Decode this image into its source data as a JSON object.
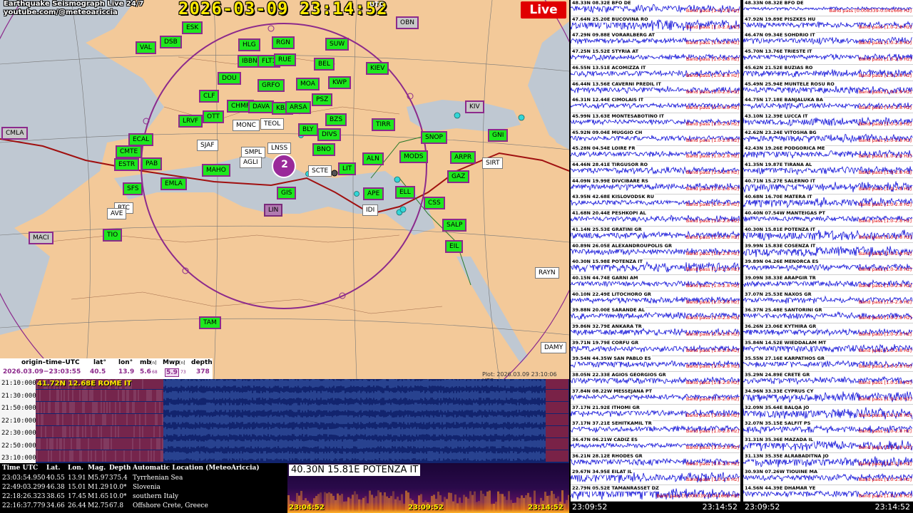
{
  "header": {
    "channel_title_line1": "Earthquake Seismograph Live 24/7",
    "channel_title_line2": "youtube.com/@meteoariccia",
    "clock": "2026-03-09  23:14:52",
    "clock_tz": "UTC",
    "live_label": "Live"
  },
  "map": {
    "plot_time": "Plot: 2026.03.09  23:10:06  UTC",
    "epicenter_label": "2",
    "colors": {
      "land": "#f3c999",
      "sea": "#bfc8d2",
      "border": "#8c2a8c",
      "ridge": "#a01010"
    },
    "stations": [
      {
        "code": "ESK",
        "style": "normal"
      },
      {
        "code": "VAL",
        "style": "normal"
      },
      {
        "code": "DSB",
        "style": "normal"
      },
      {
        "code": "HLG",
        "style": "normal"
      },
      {
        "code": "RGN",
        "style": "normal"
      },
      {
        "code": "SUW",
        "style": "normal"
      },
      {
        "code": "OBN",
        "style": "gray"
      },
      {
        "code": "IBBN",
        "style": "normal"
      },
      {
        "code": "FLT1",
        "style": "normal"
      },
      {
        "code": "RUE",
        "style": "normal"
      },
      {
        "code": "BEL",
        "style": "normal"
      },
      {
        "code": "KIEV",
        "style": "normal"
      },
      {
        "code": "DOU",
        "style": "normal"
      },
      {
        "code": "GRFO",
        "style": "normal"
      },
      {
        "code": "MOA",
        "style": "normal"
      },
      {
        "code": "KWP",
        "style": "normal"
      },
      {
        "code": "CLF",
        "style": "normal"
      },
      {
        "code": "CHMF",
        "style": "normal"
      },
      {
        "code": "DAVA",
        "style": "normal"
      },
      {
        "code": "KBA",
        "style": "normal"
      },
      {
        "code": "ARSA",
        "style": "normal"
      },
      {
        "code": "PSZ",
        "style": "normal"
      },
      {
        "code": "BZS",
        "style": "normal"
      },
      {
        "code": "TIRR",
        "style": "normal"
      },
      {
        "code": "LRVF",
        "style": "normal"
      },
      {
        "code": "OTT",
        "style": "normal"
      },
      {
        "code": "MONC",
        "style": "white"
      },
      {
        "code": "TEOL",
        "style": "white"
      },
      {
        "code": "BLY",
        "style": "normal"
      },
      {
        "code": "DIVS",
        "style": "normal"
      },
      {
        "code": "KIV",
        "style": "gray"
      },
      {
        "code": "GNI",
        "style": "normal"
      },
      {
        "code": "CMLA",
        "style": "gray"
      },
      {
        "code": "ECAL",
        "style": "normal"
      },
      {
        "code": "SJAF",
        "style": "white"
      },
      {
        "code": "SMPL",
        "style": "white"
      },
      {
        "code": "LNSS",
        "style": "white"
      },
      {
        "code": "BNO",
        "style": "normal"
      },
      {
        "code": "SNOP",
        "style": "normal"
      },
      {
        "code": "ARPR",
        "style": "normal"
      },
      {
        "code": "CMTE",
        "style": "normal"
      },
      {
        "code": "PAB",
        "style": "normal"
      },
      {
        "code": "AGLI",
        "style": "white"
      },
      {
        "code": "ALN",
        "style": "normal"
      },
      {
        "code": "MODS",
        "style": "normal"
      },
      {
        "code": "GAZ",
        "style": "normal"
      },
      {
        "code": "SIRT",
        "style": "white"
      },
      {
        "code": "MAHO",
        "style": "normal"
      },
      {
        "code": "SCTE",
        "style": "white"
      },
      {
        "code": "LIT",
        "style": "normal"
      },
      {
        "code": "ESTR",
        "style": "normal"
      },
      {
        "code": "SFS",
        "style": "normal"
      },
      {
        "code": "EMLA",
        "style": "normal"
      },
      {
        "code": "GIS",
        "style": "normal"
      },
      {
        "code": "APE",
        "style": "normal"
      },
      {
        "code": "ELL",
        "style": "normal"
      },
      {
        "code": "CSS",
        "style": "normal"
      },
      {
        "code": "RTC",
        "style": "white"
      },
      {
        "code": "AVE",
        "style": "white"
      },
      {
        "code": "IDI",
        "style": "white"
      },
      {
        "code": "LIN",
        "style": "purple"
      },
      {
        "code": "TIO",
        "style": "normal"
      },
      {
        "code": "SALP",
        "style": "normal"
      },
      {
        "code": "MACI",
        "style": "gray"
      },
      {
        "code": "EIL",
        "style": "normal"
      },
      {
        "code": "RAYN",
        "style": "white"
      },
      {
        "code": "TAM",
        "style": "normal"
      },
      {
        "code": "DAMY",
        "style": "white"
      }
    ]
  },
  "event": {
    "headers": {
      "origin": "origin–time–UTC",
      "lat": "lat°",
      "lon": "lon°",
      "mb": "mb",
      "mb_sub": "[n]",
      "mwp": "Mwp",
      "mwp_sub": "[n]",
      "depth": "depth"
    },
    "values": {
      "origin": "2026.03.09−23:03:55",
      "lat": "40.5",
      "lon": "13.9",
      "mb": "5.6",
      "mb_n": "68",
      "mwp": "5.9",
      "mwp_n": "73",
      "depth": "378"
    }
  },
  "helicorder": {
    "station_label": "41.72N 12.68E ROME IT",
    "times": [
      "21:10:000",
      "21:30:000",
      "21:50:000",
      "22:10:000",
      "22:30:000",
      "22:50:000",
      "23:10:000"
    ]
  },
  "quake_list": {
    "headers": [
      "Time UTC",
      "Lat.",
      "Lon.",
      "Mag.",
      "Depth",
      "Automatic Location (MeteoAriccia)"
    ],
    "rows": [
      [
        "23:03:54.950",
        "40.55",
        "13.91",
        "M5.97",
        "375.4",
        "Tyrrhenian Sea"
      ],
      [
        "22:49:03.299",
        "46.38",
        "15.01",
        "M1.29",
        "10.0*",
        "Slovenia"
      ],
      [
        "22:18:26.323",
        "38.65",
        "17.45",
        "M1.65",
        "10.0*",
        "southern Italy"
      ],
      [
        "22:16:37.779",
        "34.66",
        "26.44",
        "M2.75",
        "67.8",
        "Offshore Crete, Greece"
      ]
    ]
  },
  "spectrogram": {
    "station_label": "40.30N 15.81E POTENZA IT",
    "times": [
      "23:04:52",
      "23:09:52",
      "23:14:52"
    ]
  },
  "seismograms": {
    "footer_start": "23:09:52",
    "footer_end": "23:14:52",
    "band_default": "Band pass [1.0-2.8 Hz]",
    "left": [
      {
        "label": "48.33N 08.32E BFO DE",
        "band": "Band pass [1.0-2.8 Hz]",
        "amp": 0.7
      },
      {
        "label": "47.64N 25.20E BUCOVINA RO",
        "band": "Band pass [1.0-2.8 Hz]",
        "amp": 1.0
      },
      {
        "label": "47.29N 09.88E VORARLBERG AT",
        "band": "Band pass [1.0-2.8 Hz]",
        "amp": 0.5
      },
      {
        "label": "47.25N 15.52E STYRIA AT",
        "band": "Band pass [1.0-2.8 Hz]",
        "amp": 0.5
      },
      {
        "label": "46.55N 13.51E ACOMIZZA IT",
        "band": "Band pass [1.0-2.8 Hz]",
        "amp": 0.6
      },
      {
        "label": "46.44N 13.56E CAVERNI PREDIL IT",
        "band": "Band pass [1.0-2.8 Hz]",
        "amp": 0.6
      },
      {
        "label": "46.31N 12.44E CIMOLAIS IT",
        "band": "Band pass [1.0-2.8 Hz]",
        "amp": 0.5
      },
      {
        "label": "45.99N 13.63E MONTESABOTINO IT",
        "band": "Band pass [1.0-2.8 Hz]",
        "amp": 0.5
      },
      {
        "label": "45.92N 09.04E MUGGIO CH",
        "band": "Band pass [1.0-2.8 Hz]",
        "amp": 0.5
      },
      {
        "label": "45.28N 04.54E LOIRE FR",
        "band": "Band pass [1.0-2.8 Hz]",
        "amp": 0.5
      },
      {
        "label": "44.46N 28.41E TIRGUSOR RO",
        "band": "Band pass [1.0-2.8 Hz]",
        "amp": 0.6
      },
      {
        "label": "44.09N 19.99E DIVCIBARE RS",
        "band": "Band pass [1.0-2.8 Hz]",
        "amp": 0.6
      },
      {
        "label": "43.95N 42.68E KISLOVODSK RU",
        "band": "Band pass [1.0-2.8 Hz]",
        "amp": 0.5
      },
      {
        "label": "41.68N 20.44E PESHKOPI AL",
        "band": "Band pass [1.0-2.8 Hz]",
        "amp": 0.6
      },
      {
        "label": "41.14N 25.53E GRATINI GR",
        "band": "Band pass [1.0-2.8 Hz]",
        "amp": 0.6
      },
      {
        "label": "40.89N 26.05E ALEXANDROUPOLIS GR",
        "band": "Band pass [1.0-2.8 Hz]",
        "amp": 0.6
      },
      {
        "label": "40.30N 15.98E POTENZA IT",
        "band": "Band pass [1.0-2.8 Hz]",
        "amp": 0.9
      },
      {
        "label": "40.15N 44.74E GARNI AM",
        "band": "Band pass [1.0-2.8 Hz]",
        "amp": 0.5
      },
      {
        "label": "40.10N 22.49E LITOCHORO GR",
        "band": "Band pass [1.0-2.8 Hz]",
        "amp": 0.6
      },
      {
        "label": "39.88N 20.00E SARANDE AL",
        "band": "Band pass [1.0-2.8 Hz]",
        "amp": 0.6
      },
      {
        "label": "39.86N 32.79E ANKARA TR",
        "band": "Band pass [1.0-2.8 Hz]",
        "amp": 0.6
      },
      {
        "label": "39.71N 19.79E CORFU GR",
        "band": "Band pass [1.0-2.8 Hz]",
        "amp": 0.6
      },
      {
        "label": "39.54N 44.35W SAN PABLO ES",
        "band": "Band pass [1.0-2.8 Hz]",
        "amp": 0.6
      },
      {
        "label": "38.05N 22.33E AGIOS GEORGIOS GR",
        "band": "Band pass [1.0-2.8 Hz]",
        "amp": 0.6
      },
      {
        "label": "37.84N 08.22W MESSEJANA PT",
        "band": "Band pass [1.0-2.8 Hz]",
        "amp": 0.5
      },
      {
        "label": "37.17N 21.92E ITHOMI GR",
        "band": "Band pass [1.0-2.8 Hz]",
        "amp": 0.6
      },
      {
        "label": "37.17N 37.21E SEHITKAMIL TR",
        "band": "Band pass [1.0-2.8 Hz]",
        "amp": 0.6
      },
      {
        "label": "36.47N 06.21W CADIZ ES",
        "band": "Band pass [1.0-2.8 Hz]",
        "amp": 0.5
      },
      {
        "label": "36.21N 28.12E RHODES GR",
        "band": "Band pass [1.0-2.8 Hz]",
        "amp": 0.6
      },
      {
        "label": "29.67N 34.95E EILAT IL",
        "band": "Band pass [1.0-2.8 Hz]",
        "amp": 0.9
      },
      {
        "label": "22.79N 05.52E TAMANRASSET DZ",
        "band": "Band pass [0.008339-0.041666 Hz]",
        "amp": 1.0
      }
    ],
    "right": [
      {
        "label": "48.33N 08.32E BFO DE",
        "band": "Band pass [0.008339-0.041666 Hz]",
        "amp": 0.3
      },
      {
        "label": "47.92N 19.89E PISZKES HU",
        "band": "Band pass [1.0-2.8 Hz]",
        "amp": 0.6
      },
      {
        "label": "46.47N 09.34E SOHDRIO IT",
        "band": "Band pass [1.0-2.8 Hz]",
        "amp": 0.6
      },
      {
        "label": "45.70N 13.76E TRIESTE IT",
        "band": "Band pass [1.0-2.8 Hz]",
        "amp": 0.6
      },
      {
        "label": "45.62N 21.52E BUZIAS RO",
        "band": "Band pass [1.0-2.8 Hz]",
        "amp": 0.7
      },
      {
        "label": "45.49N 25.94E MUNTELE ROSU RO",
        "band": "Band pass [1.0-2.8 Hz]",
        "amp": 0.7
      },
      {
        "label": "44.75N 17.18E BANJALUKA BA",
        "band": "Band pass [1.0-2.8 Hz]",
        "amp": 0.6
      },
      {
        "label": "43.10N 12.39E LUCCA IT",
        "band": "Band pass [1.0-2.8 Hz]",
        "amp": 0.7
      },
      {
        "label": "42.62N 23.24E VITOSHA BG",
        "band": "Band pass [1.0-2.8 Hz]",
        "amp": 0.7
      },
      {
        "label": "42.43N 19.26E PODGORICA ME",
        "band": "Band pass [1.0-2.8 Hz]",
        "amp": 0.7
      },
      {
        "label": "41.35N 19.87E TIRANA AL",
        "band": "Band pass [1.0-2.8 Hz]",
        "amp": 0.7
      },
      {
        "label": "40.71N 15.27E SALERNO IT",
        "band": "Band pass [1.0-2.8 Hz]",
        "amp": 0.9
      },
      {
        "label": "40.68N 16.70E MATERA IT",
        "band": "Band pass [1.0-2.8 Hz]",
        "amp": 0.9
      },
      {
        "label": "40.40N 07.54W MANTEIGAS PT",
        "band": "Band pass [1.0-2.8 Hz]",
        "amp": 0.5
      },
      {
        "label": "40.30N 15.81E POTENZA IT",
        "band": "Band pass [1.0-2.8 Hz]",
        "amp": 0.9
      },
      {
        "label": "39.99N 15.83E COSENZA IT",
        "band": "Band pass [1.0-2.8 Hz]",
        "amp": 0.9
      },
      {
        "label": "39.89N 04.26E MENORCA ES",
        "band": "Band pass [1.0-2.8 Hz]",
        "amp": 0.6
      },
      {
        "label": "39.09N 38.33E ARAPGIR TR",
        "band": "Band pass [1.0-2.8 Hz]",
        "amp": 0.6
      },
      {
        "label": "37.07N 25.53E NAXOS GR",
        "band": "Band pass [1.0-2.8 Hz]",
        "amp": 0.6
      },
      {
        "label": "36.37N 25.48E SANTORINI GR",
        "band": "Band pass [1.0-2.8 Hz]",
        "amp": 0.6
      },
      {
        "label": "36.26N 23.06E KYTHIRA GR",
        "band": "Band pass [1.0-2.8 Hz]",
        "amp": 0.6
      },
      {
        "label": "35.84N 14.52E WIEDDALAM MT",
        "band": "Band pass [1.0-2.8 Hz]",
        "amp": 0.7
      },
      {
        "label": "35.55N 27.16E KARPATHOS GR",
        "band": "Band pass [1.0-2.8 Hz]",
        "amp": 0.6
      },
      {
        "label": "35.29N 24.89E CRETE GR",
        "band": "Band pass [1.0-2.8 Hz]",
        "amp": 0.6
      },
      {
        "label": "34.96N 33.33E CYPRUS CY",
        "band": "Band pass [1.0-2.8 Hz]",
        "amp": 0.9
      },
      {
        "label": "32.09N 35.64E BALQA JO",
        "band": "Band pass [1.0-2.8 Hz]",
        "amp": 1.0
      },
      {
        "label": "32.07N 35.15E SALFIT PS",
        "band": "Band pass [1.0-2.8 Hz]",
        "amp": 0.7
      },
      {
        "label": "31.31N 35.36E MAZADA IL",
        "band": "Band pass [1.0-2.8 Hz]",
        "amp": 0.9
      },
      {
        "label": "31.13N 35.35E ALRABADITNA JO",
        "band": "Band pass [1.0-2.8 Hz]",
        "amp": 0.9
      },
      {
        "label": "30.93N 07.26W TIOUINE MA",
        "band": "Band pass [1.0-2.8 Hz]",
        "amp": 0.6
      },
      {
        "label": "14.56N 44.39E DHAMAR YE",
        "band": "Band pass [1.0-2.8 Hz]",
        "amp": 0.6
      }
    ]
  }
}
